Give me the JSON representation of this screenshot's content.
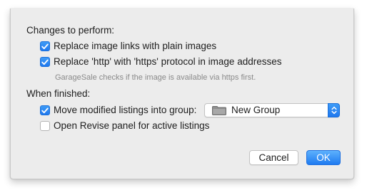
{
  "dialog": {
    "changes_section": {
      "label": "Changes to perform:",
      "options": [
        {
          "label": "Replace image links with plain images",
          "checked": true
        },
        {
          "label": "Replace 'http' with 'https' protocol in image addresses",
          "checked": true
        }
      ],
      "hint": "GarageSale checks if the image is available via https first."
    },
    "finished_section": {
      "label": "When finished:",
      "move_option": {
        "label": "Move modified listings into group:",
        "checked": true
      },
      "group_select": {
        "value": "New Group",
        "icon": "folder-icon"
      },
      "revise_option": {
        "label": "Open Revise panel for active listings",
        "checked": false
      }
    },
    "buttons": {
      "cancel": "Cancel",
      "ok": "OK"
    }
  },
  "colors": {
    "accent": "#1f78ee",
    "background": "#ececec",
    "hint_text": "#8a8a8a"
  }
}
